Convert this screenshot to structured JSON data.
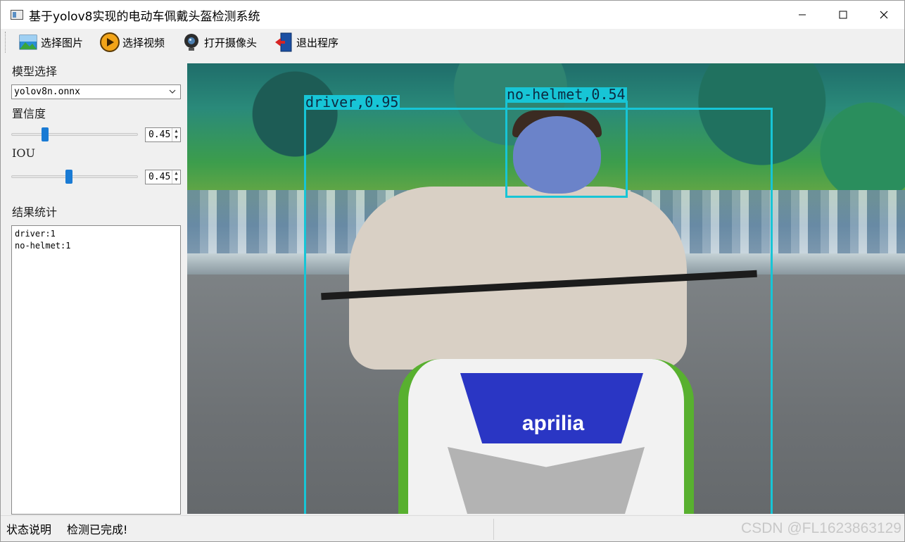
{
  "window": {
    "title": "基于yolov8实现的电动车佩戴头盔检测系统"
  },
  "toolbar": {
    "items": [
      {
        "label": "选择图片",
        "icon": "image-icon"
      },
      {
        "label": "选择视频",
        "icon": "play-icon"
      },
      {
        "label": "打开摄像头",
        "icon": "webcam-icon"
      },
      {
        "label": "退出程序",
        "icon": "exit-door-icon"
      }
    ]
  },
  "left_panel": {
    "model_label": "模型选择",
    "model_value": "yolov8n.onnx",
    "conf_label": "置信度",
    "conf_value": "0.45",
    "iou_label": "IOU",
    "iou_value": "0.45",
    "results_label": "结果统计",
    "results_lines": [
      "driver:1",
      "no-helmet:1"
    ]
  },
  "detections": [
    {
      "label": "driver,0.95",
      "color": "#17c5d6"
    },
    {
      "label": "no-helmet,0.54",
      "color": "#17c5d6"
    }
  ],
  "image_text": {
    "scooter_brand": "aprilia"
  },
  "status_bar": {
    "title": "状态说明",
    "message": "检测已完成!",
    "watermark": "CSDN @FL1623863129"
  }
}
